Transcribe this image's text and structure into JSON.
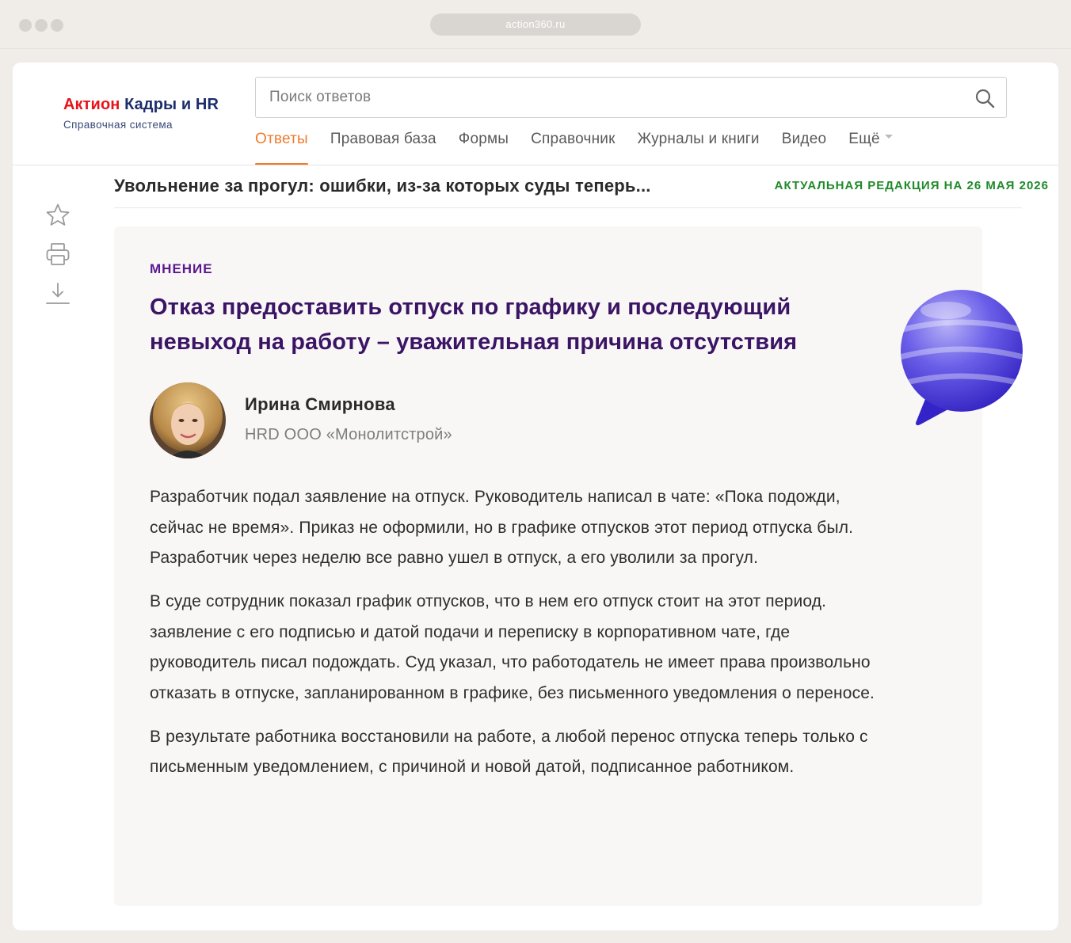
{
  "browser": {
    "url": "action360.ru"
  },
  "logo": {
    "brand": "Актион",
    "product": "Кадры и HR",
    "subtitle": "Справочная система"
  },
  "search": {
    "placeholder": "Поиск ответов",
    "value": ""
  },
  "nav": {
    "items": [
      {
        "label": "Ответы",
        "active": true
      },
      {
        "label": "Правовая база"
      },
      {
        "label": "Формы"
      },
      {
        "label": "Справочник"
      },
      {
        "label": "Журналы и книги"
      },
      {
        "label": "Видео"
      },
      {
        "label": "Ещё",
        "dropdown": true
      }
    ]
  },
  "document": {
    "title": "Увольнение за прогул: ошибки, из-за которых суды теперь...",
    "edition": "АКТУАЛЬНАЯ РЕДАКЦИЯ НА 26 МАЯ 2026"
  },
  "toolbar": {
    "icons": [
      "star-icon",
      "print-icon",
      "download-icon"
    ]
  },
  "article": {
    "tag": "МНЕНИЕ",
    "title": "Отказ предоставить отпуск по графику и последующий невыход на работу – уважительная причина отсутствия",
    "author": {
      "name": "Ирина Смирнова",
      "role": "HRD ООО «Монолитстрой»"
    },
    "paragraphs": [
      "Разработчик подал заявление на отпуск. Руководитель написал в чате: «Пока подожди, сейчас не время». Приказ не оформили, но в графике отпусков этот период отпуска был. Разработчик через неделю все равно ушел в отпуск, а его уволили за прогул.",
      "В суде сотрудник показал график отпусков, что в нем его отпуск стоит на этот период. заявление с его подписью и датой подачи и переписку в корпоративном чате, где руководитель писал подождать. Суд указал, что работодатель не имеет права произвольно отказать в отпуске, запланированном в графике, без письменного уведомления о переносе.",
      "В результате работника восстановили на работе, а любой перенос отпуска теперь только с письменным уведомлением, с причиной и новой датой, подписанное работником."
    ]
  },
  "colors": {
    "accent": "#f07a2c",
    "brand_red": "#e8131a",
    "brand_blue": "#1c2d6b",
    "tag_purple": "#5a1890",
    "title_purple": "#3b1465",
    "edition_green": "#1f8a2a"
  }
}
